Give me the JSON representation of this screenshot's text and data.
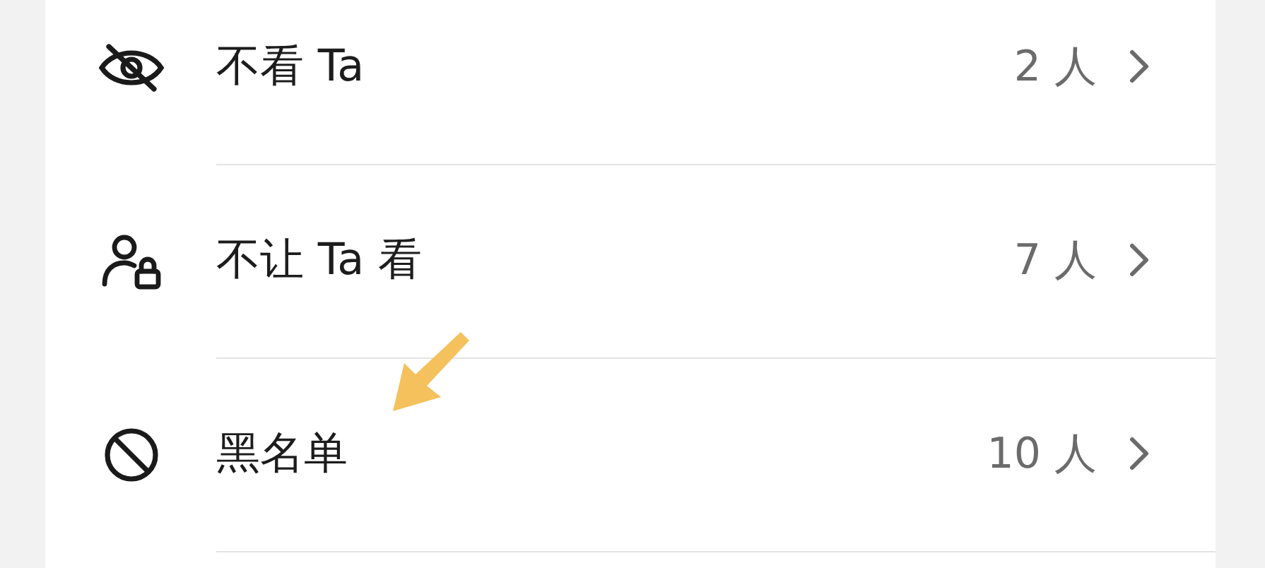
{
  "rows": [
    {
      "kind": "eye-off",
      "label": "不看 Ta",
      "count": "2 人",
      "highlighted": false
    },
    {
      "kind": "person-lock",
      "label": "不让 Ta 看",
      "count": "7 人",
      "highlighted": false
    },
    {
      "kind": "ban",
      "label": "黑名单",
      "count": "10 人",
      "highlighted": true
    }
  ]
}
